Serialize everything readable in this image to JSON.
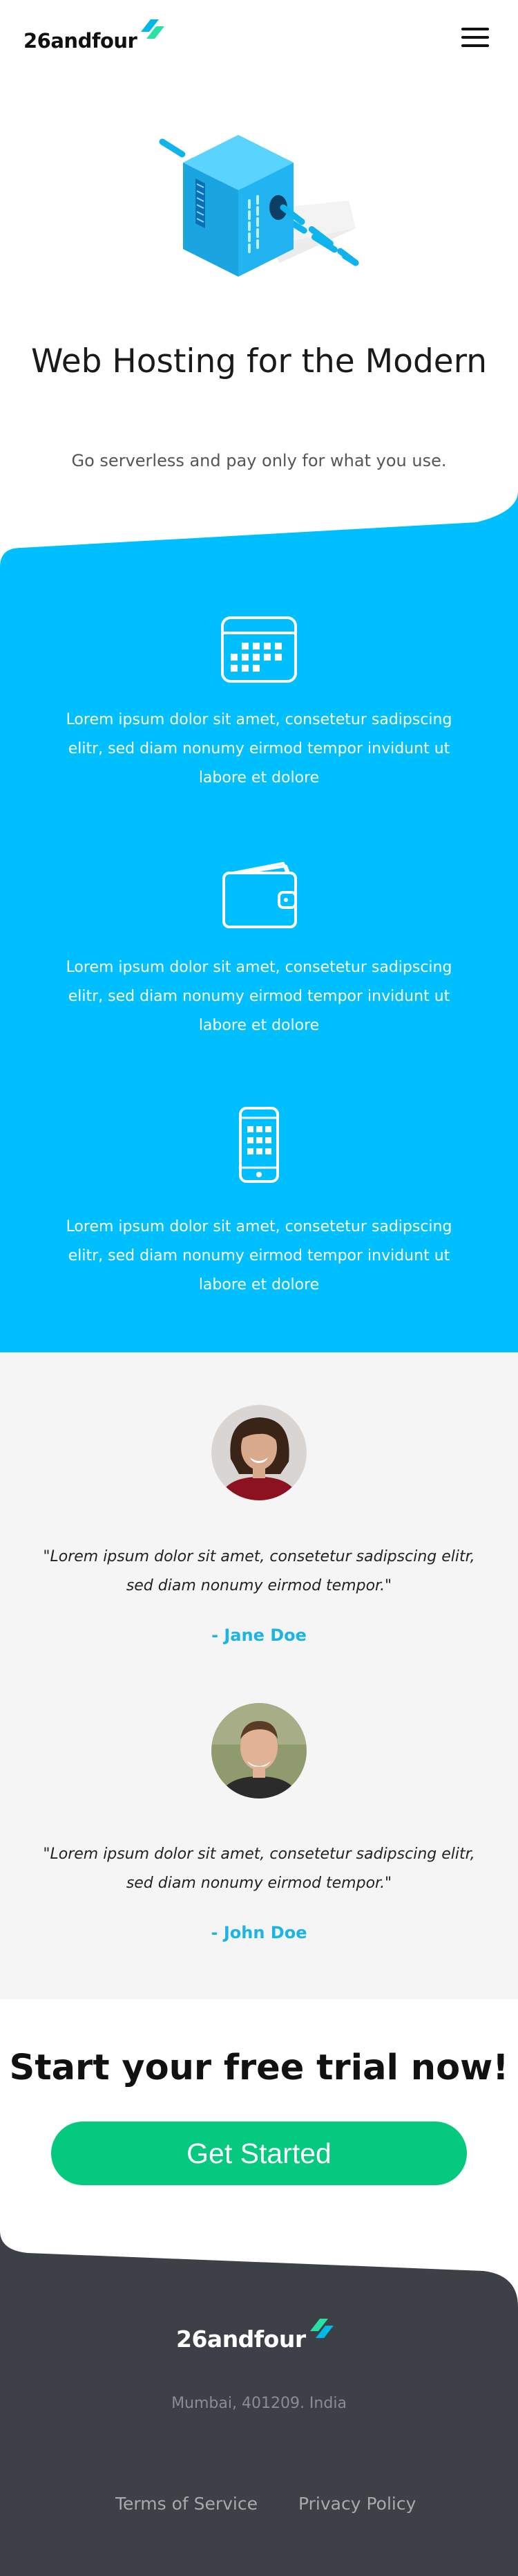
{
  "brand": {
    "name": "26andfour",
    "accent": "#00bfff",
    "mark_colors": [
      "#00b7e6",
      "#29e0a6"
    ]
  },
  "header": {
    "menu_icon": "hamburger-menu-icon"
  },
  "hero": {
    "illustration": "server-cube-illustration",
    "title": "Web Hosting for the Modern",
    "subtitle": "Go serverless and pay only for what you use."
  },
  "features": {
    "background": "#00bfff",
    "items": [
      {
        "icon": "calendar-icon",
        "text": "Lorem ipsum dolor sit amet, consetetur sadipscing elitr, sed diam nonumy eirmod tempor invidunt ut labore et dolore"
      },
      {
        "icon": "wallet-icon",
        "text": "Lorem ipsum dolor sit amet, consetetur sadipscing elitr, sed diam nonumy eirmod tempor invidunt ut labore et dolore"
      },
      {
        "icon": "smartphone-icon",
        "text": "Lorem ipsum dolor sit amet, consetetur sadipscing elitr, sed diam nonumy eirmod tempor invidunt ut labore et dolore"
      }
    ]
  },
  "testimonials": [
    {
      "quote": "\"Lorem ipsum dolor sit amet, consetetur sadipscing elitr, sed diam nonumy eirmod tempor.\"",
      "author": "- Jane Doe"
    },
    {
      "quote": "\"Lorem ipsum dolor sit amet, consetetur sadipscing elitr, sed diam nonumy eirmod tempor.\"",
      "author": "- John Doe"
    }
  ],
  "cta": {
    "title": "Start your free trial now!",
    "button_label": "Get Started",
    "button_color": "#05c97e"
  },
  "footer": {
    "background": "#3d4046",
    "address": "Mumbai, 401209. India",
    "links": [
      "Terms of Service",
      "Privacy Policy"
    ]
  }
}
